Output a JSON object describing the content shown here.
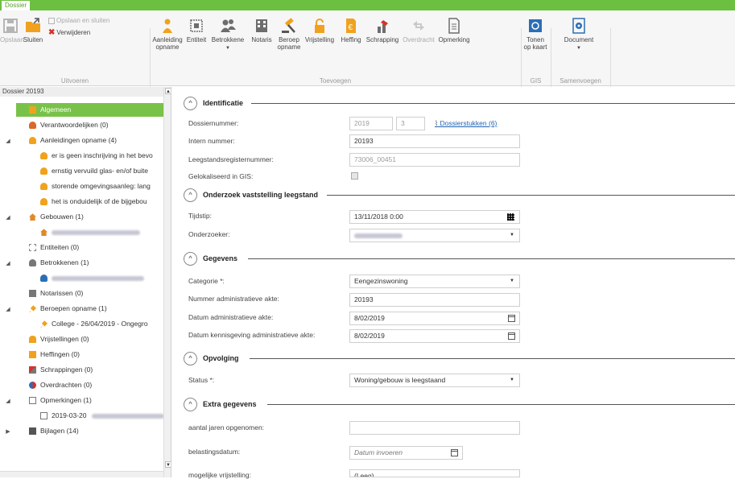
{
  "ribbon": {
    "tab": "Dossier",
    "buttons": {
      "opslaan": "Opslaan",
      "sluiten": "Sluiten",
      "opslaan_en_sluiten": "Opslaan en sluiten",
      "verwijderen": "Verwijderen",
      "aanleiding_opname_1": "Aanleiding",
      "aanleiding_opname_2": "opname",
      "entiteit": "Entiteit",
      "betrokkene": "Betrokkene",
      "notaris": "Notaris",
      "beroep_opname_1": "Beroep",
      "beroep_opname_2": "opname",
      "vrijstelling": "Vrijstelling",
      "heffing": "Heffing",
      "schrapping": "Schrapping",
      "overdracht": "Overdracht",
      "opmerking": "Opmerking",
      "tonen_op_kaart_1": "Tonen",
      "tonen_op_kaart_2": "op kaart",
      "document": "Document"
    },
    "groups": {
      "uitvoeren": "Uitvoeren",
      "toevoegen": "Toevoegen",
      "gis": "GIS",
      "samenvoegen": "Samenvoegen"
    },
    "colors": {
      "accent": "#6cbf40",
      "icon_orange": "#f0a21e",
      "icon_gray": "#6d6d6d",
      "icon_blue": "#2a6fb5",
      "delete_red": "#d6312a"
    }
  },
  "tree": {
    "header": "Dossier 20193",
    "items": [
      {
        "label": "Algemeen",
        "selected": true,
        "icon": "folder-icon"
      },
      {
        "label": "Verantwoordelijken (0)",
        "icon": "person-icon"
      },
      {
        "label": "Aanleidingen opname (4)",
        "icon": "warning-icon",
        "expanded": true
      },
      {
        "label": "er is geen inschrijving in het bevo",
        "icon": "warning-icon"
      },
      {
        "label": "ernstig vervuild glas- en/of buite",
        "icon": "warning-icon"
      },
      {
        "label": "storende omgevingsaanleg: lang",
        "icon": "warning-icon"
      },
      {
        "label": "het is onduidelijk of de bijgebou",
        "icon": "warning-icon"
      },
      {
        "label": "Gebouwen (1)",
        "icon": "house-icon",
        "expanded": true
      },
      {
        "label": "Entiteiten (0)",
        "icon": "entity-icon"
      },
      {
        "label": "Betrokkenen (1)",
        "icon": "people-icon",
        "expanded": true
      },
      {
        "label": "Notarissen (0)",
        "icon": "building-icon"
      },
      {
        "label": "Beroepen opname (1)",
        "icon": "gavel-icon",
        "expanded": true
      },
      {
        "label": "College - 26/04/2019 - Ongegro",
        "icon": "gavel-icon"
      },
      {
        "label": "Vrijstellingen (0)",
        "icon": "lock-icon"
      },
      {
        "label": "Heffingen (0)",
        "icon": "invoice-icon"
      },
      {
        "label": "Schrappingen (0)",
        "icon": "eraser-icon"
      },
      {
        "label": "Overdrachten (0)",
        "icon": "transfer-icon"
      },
      {
        "label": "Opmerkingen (1)",
        "icon": "note-icon",
        "expanded": true
      },
      {
        "label": "2019-03-20",
        "icon": "note-icon"
      },
      {
        "label": "Bijlagen (14)",
        "icon": "attachment-icon",
        "expanded": false
      }
    ]
  },
  "form": {
    "identificatie": {
      "title": "Identificatie",
      "dossiernummer_label": "Dossiernummer:",
      "dossiernummer_jaar": "2019",
      "dossiernummer_nr": "3",
      "dossierstukken_link": "Dossierstukken (6)",
      "intern_nummer_label": "Intern nummer:",
      "intern_nummer": "20193",
      "leegstandsregisternummer_label": "Leegstandsregisternummer:",
      "leegstandsregisternummer": "73006_00451",
      "gelokaliseerd_label": "Gelokaliseerd in GIS:"
    },
    "onderzoek": {
      "title": "Onderzoek vaststelling leegstand",
      "tijdstip_label": "Tijdstip:",
      "tijdstip": "13/11/2018 0:00",
      "onderzoeker_label": "Onderzoeker:"
    },
    "gegevens": {
      "title": "Gegevens",
      "categorie_label": "Categorie *:",
      "categorie": "Eengezinswoning",
      "nummer_akte_label": "Nummer administratieve akte:",
      "nummer_akte": "20193",
      "datum_akte_label": "Datum administratieve akte:",
      "datum_akte": "8/02/2019",
      "datum_kennisgeving_label": "Datum kennisgeving administratieve akte:",
      "datum_kennisgeving": "8/02/2019"
    },
    "opvolging": {
      "title": "Opvolging",
      "status_label": "Status *:",
      "status": "Woning/gebouw is leegstaand"
    },
    "extra": {
      "title": "Extra gegevens",
      "aantal_jaren_label": "aantal jaren opgenomen:",
      "aantal_jaren": "",
      "belastingsdatum_label": "belastingsdatum:",
      "belastingsdatum_placeholder": "Datum invoeren",
      "mogelijke_vrijstelling_label": "mogelijke vrijstelling:",
      "mogelijke_vrijstelling": "(Leeg)"
    }
  }
}
